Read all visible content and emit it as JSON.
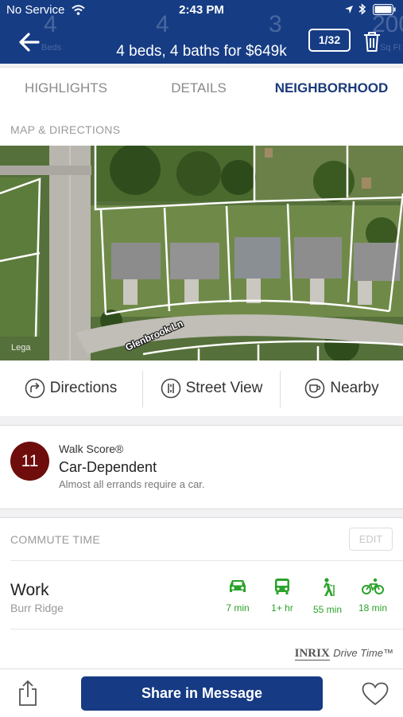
{
  "status_bar": {
    "carrier": "No Service",
    "time": "2:43 PM"
  },
  "header": {
    "ghost_values": [
      "4",
      "4",
      "3",
      "200"
    ],
    "ghost_captions": [
      "Beds",
      "Sq Ft"
    ],
    "title": "4 beds, 4 baths for $649k",
    "counter": "1/32"
  },
  "tabs": [
    {
      "label": "HIGHLIGHTS",
      "active": false
    },
    {
      "label": "DETAILS",
      "active": false
    },
    {
      "label": "NEIGHBORHOOD",
      "active": true
    }
  ],
  "map_section": {
    "title": "MAP & DIRECTIONS",
    "street_label": "Glenbrook Ln",
    "legal_label": "Lega",
    "buttons": {
      "directions": "Directions",
      "street_view": "Street View",
      "nearby": "Nearby"
    }
  },
  "walk_score": {
    "score": "11",
    "label": "Walk Score®",
    "rating": "Car-Dependent",
    "description": "Almost all errands require a car.",
    "badge_color": "#6e0d0b"
  },
  "commute": {
    "title": "COMMUTE TIME",
    "edit_label": "EDIT",
    "destination": "Work",
    "location": "Burr Ridge",
    "modes": [
      {
        "icon": "car-icon",
        "time": "7 min"
      },
      {
        "icon": "bus-icon",
        "time": "1+ hr"
      },
      {
        "icon": "walk-icon",
        "time": "55 min"
      },
      {
        "icon": "bike-icon",
        "time": "18 min"
      }
    ],
    "brand_main": "INRIX",
    "brand_sub": "Drive Time™",
    "accent_color": "#2aa32a"
  },
  "footer": {
    "share_label": "Share in Message"
  },
  "colors": {
    "header_bg": "#163c84",
    "button_bg": "#163a84",
    "active_tab": "#1b3a7a"
  }
}
